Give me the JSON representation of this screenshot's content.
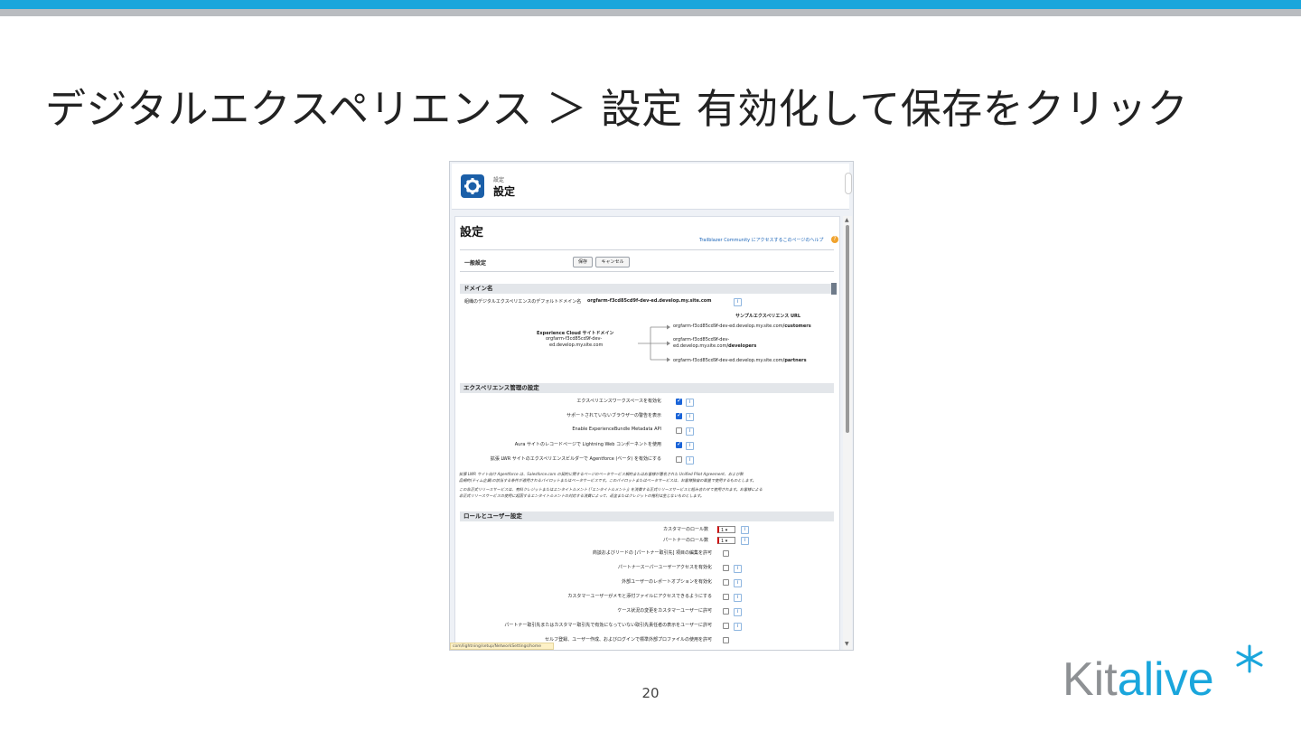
{
  "slide": {
    "title": "デジタルエクスペリエンス ＞ 設定 有効化して保存をクリック",
    "page_number": "20",
    "logo_text_gray": "Kit",
    "logo_text_blue": "alive",
    "colors": {
      "accent_bar": "#1aa6dc",
      "sub_bar": "#b9bcc0",
      "logo_gray": "#8e9194",
      "logo_blue": "#1aa6dc"
    }
  },
  "header": {
    "small": "設定",
    "title": "設定",
    "icon": "gear-icon"
  },
  "page": {
    "title": "設定",
    "help_link": "Trailblazer Community にアクセスするこのページのヘルプ",
    "general_label": "一般設定",
    "save_label": "保存",
    "cancel_label": "キャンセル"
  },
  "domain": {
    "section_title": "ドメイン名",
    "default_domain_label": "組織のデジタルエクスペリエンスのデフォルトドメイン名",
    "default_domain_value": "orgfarm-f3cd85cd9f-dev-ed.develop.my.site.com",
    "sample_url_title": "サンプルエクスペリエンス URL",
    "site_domain_title": "Experience Cloud サイトドメイン",
    "site_domain_line1": "orgfarm-f3cd85cd9f-dev-",
    "site_domain_line2": "ed.develop.my.site.com",
    "url1_prefix": "orgfarm-f3cd85cd9f-dev-ed.develop.my.site.com",
    "url1_suffix": "/customers",
    "url2_line1": "orgfarm-f3cd85cd9f-dev-",
    "url2_prefix": "ed.develop.my.site.com",
    "url2_suffix": "/developers",
    "url3_prefix": "orgfarm-f3cd85cd9f-dev-ed.develop.my.site.com",
    "url3_suffix": "/partners"
  },
  "experience": {
    "section_title": "エクスペリエンス管理の設定",
    "items": [
      {
        "label": "エクスペリエンスワークスペースを有効化",
        "checked": true
      },
      {
        "label": "サポートされていないブラウザーの警告を表示",
        "checked": true
      },
      {
        "label": "Enable ExperienceBundle Metadata API",
        "checked": false
      },
      {
        "label": "Aura サイトのレコードページで Lightning Web コンポーネントを使用",
        "checked": true
      },
      {
        "label": "拡張 LWR サイトのエクスペリエンスビルダーで Agentforce (ベータ) を有効にする",
        "checked": false
      }
    ],
    "note1_line1": "拡張 LWR サイト向け Agentforce は、Salesforce.com の契約に関するページのベータサービス規約またはお客様が署名された Unified Pilot Agreement、および製",
    "note1_line2": "品規約(ティム企業)の該当する条件が適用されるパイロットまたはベータサービスです。このパイロットまたはベータサービスは、お客様独自の裁量で使用するものとします。",
    "note2_line1": "この非正式リリースサービスは、有料クレジットまたはエンタイトルメント (「エンタイトルメント」) を消費する正式リリースサービスと組み合わせて使用されます。お客様による",
    "note2_line2": "非正式リリースサービスの使用に起因するエンタイトルメントの対応する消費によって、返金またはクレジットの権利は生じないものとします。"
  },
  "roles": {
    "section_title": "ロールとユーザー設定",
    "customer_roles_label": "カスタマーのロール数",
    "customer_roles_value": "1",
    "partner_roles_label": "パートナーのロール数",
    "partner_roles_value": "1",
    "items": [
      {
        "label": "商談およびリードの [パートナー取引先] 項目の編集を許可",
        "checked": false
      },
      {
        "label": "パートナースーパーユーザーアクセスを有効化",
        "checked": false
      },
      {
        "label": "外部ユーザーのレポートオプションを有効化",
        "checked": false
      },
      {
        "label": "カスタマーユーザーがメモと添付ファイルにアクセスできるようにする",
        "checked": false
      },
      {
        "label": "ケース状況の変更をカスタマーユーザーに許可",
        "checked": false
      },
      {
        "label": "パートナー取引先またはカスタマー取引先で有効になっていない取引先責任者の表示をユーザーに許可",
        "checked": false
      },
      {
        "label": "セルフ登録、ユーザー作成、およびログインで標準外部プロファイルの使用を許可",
        "checked": false
      }
    ]
  },
  "status_url": "com/lightning/setup/NetworkSettings/home"
}
